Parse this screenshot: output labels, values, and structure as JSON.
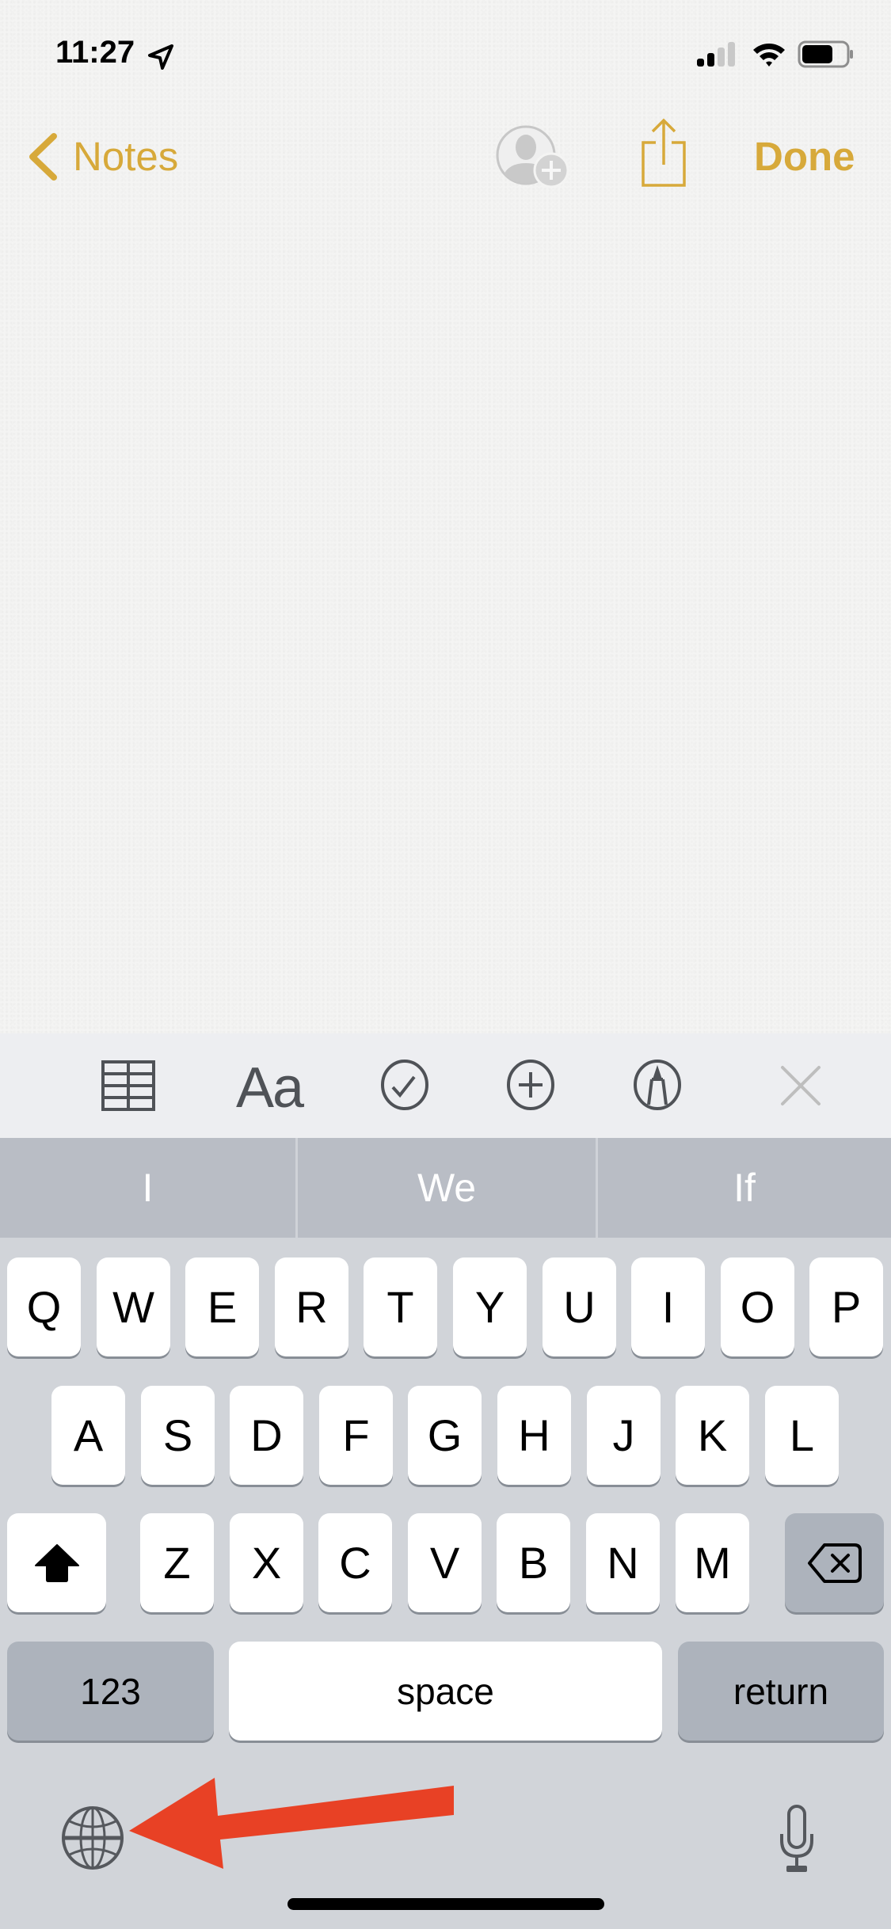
{
  "status_bar": {
    "time": "11:27",
    "location_icon": "location-arrow-icon",
    "signal_bars_filled": 2,
    "signal_bars_total": 4,
    "wifi_icon": "wifi-icon",
    "battery_level_percent": 70
  },
  "nav": {
    "back_label": "Notes",
    "back_icon": "chevron-left-icon",
    "add_people_icon": "add-person-icon",
    "share_icon": "share-icon",
    "done_label": "Done",
    "accent_color": "#D7A93A"
  },
  "note": {
    "body": ""
  },
  "toolbar": {
    "items": [
      {
        "name": "table",
        "icon": "table-icon"
      },
      {
        "name": "format",
        "label": "Aa"
      },
      {
        "name": "checklist",
        "icon": "checklist-icon"
      },
      {
        "name": "add",
        "icon": "plus-circle-icon"
      },
      {
        "name": "markup",
        "icon": "markup-pen-icon"
      },
      {
        "name": "close",
        "icon": "close-icon"
      }
    ]
  },
  "predictions": [
    "I",
    "We",
    "If"
  ],
  "keyboard": {
    "row1": [
      "Q",
      "W",
      "E",
      "R",
      "T",
      "Y",
      "U",
      "I",
      "O",
      "P"
    ],
    "row2": [
      "A",
      "S",
      "D",
      "F",
      "G",
      "H",
      "J",
      "K",
      "L"
    ],
    "row3": [
      "Z",
      "X",
      "C",
      "V",
      "B",
      "N",
      "M"
    ],
    "shift_active": true,
    "numbers_label": "123",
    "space_label": "space",
    "return_label": "return",
    "globe_icon": "globe-icon",
    "mic_icon": "microphone-icon",
    "delete_icon": "delete-backward-icon"
  },
  "annotation": {
    "arrow_color": "#E84125",
    "points_to": "globe-icon"
  }
}
